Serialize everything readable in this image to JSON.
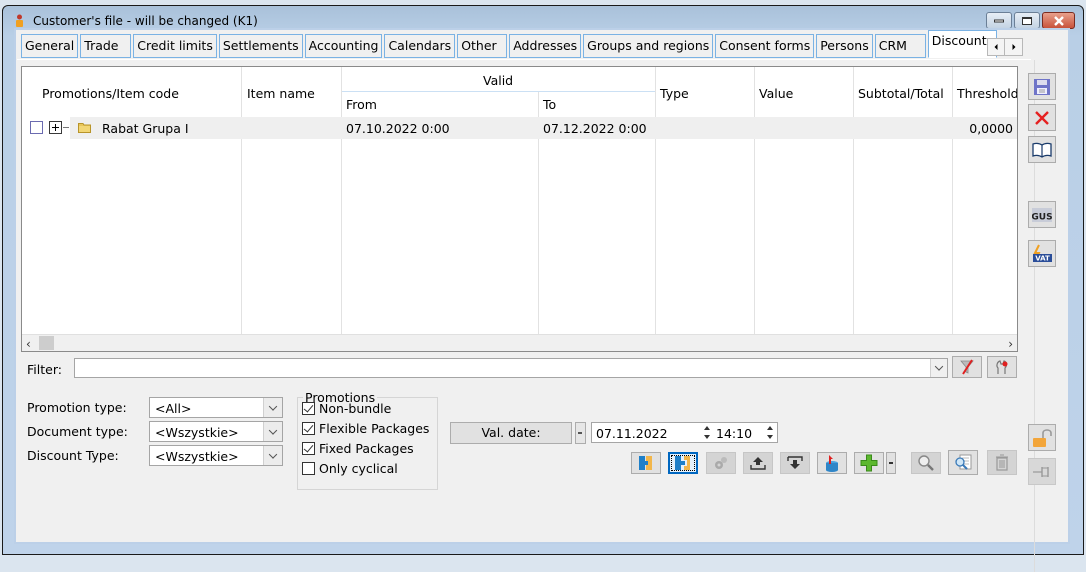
{
  "window": {
    "title": "Customer's file - will be changed (K1)",
    "controls": [
      "minimize",
      "maximize",
      "close"
    ]
  },
  "tabs": [
    {
      "label": "General",
      "active": false
    },
    {
      "label": "Trade",
      "active": false
    },
    {
      "label": "Credit limits",
      "active": false
    },
    {
      "label": "Settlements",
      "active": false
    },
    {
      "label": "Accounting",
      "active": false
    },
    {
      "label": "Calendars",
      "active": false
    },
    {
      "label": "Other",
      "active": false
    },
    {
      "label": "Addresses",
      "active": false
    },
    {
      "label": "Groups and regions",
      "active": false
    },
    {
      "label": "Consent forms",
      "active": false
    },
    {
      "label": "Persons",
      "active": false
    },
    {
      "label": "CRM",
      "active": false
    },
    {
      "label": "Discounts",
      "active": true
    }
  ],
  "grid": {
    "columns": {
      "code": "Promotions/Item code",
      "name": "Item name",
      "valid": "Valid",
      "from": "From",
      "to": "To",
      "type": "Type",
      "value": "Value",
      "subtotal": "Subtotal/Total",
      "threshold": "Threshold"
    },
    "rows": [
      {
        "checked": false,
        "expandable": true,
        "icon": "folder-icon",
        "code": "Rabat Grupa I",
        "name": "",
        "from": "07.10.2022  0:00",
        "to": "07.12.2022  0:00",
        "type": "",
        "value": "",
        "subtotal": "",
        "threshold": "0,0000"
      }
    ]
  },
  "filter": {
    "label": "Filter:",
    "value": "",
    "clear_icon": "clear-filter-icon",
    "build_icon": "filter-builder-icon"
  },
  "form": {
    "promotion_type": {
      "label": "Promotion type:",
      "value": "<All>"
    },
    "document_type": {
      "label": "Document type:",
      "value": "<Wszystkie>"
    },
    "discount_type": {
      "label": "Discount Type:",
      "value": "<Wszystkie>"
    }
  },
  "promotions": {
    "title": "Promotions",
    "options": [
      {
        "label": "Non-bundle",
        "checked": true
      },
      {
        "label": "Flexible Packages",
        "checked": true
      },
      {
        "label": "Fixed Packages",
        "checked": true
      },
      {
        "label": "Only cyclical",
        "checked": false
      }
    ]
  },
  "validity": {
    "button_label": "Val. date:",
    "date": "07.11.2022",
    "time": "14:10"
  },
  "toolbar": [
    {
      "name": "attach-button",
      "icon": "attach-icon",
      "disabled": false
    },
    {
      "name": "attach-all-button",
      "icon": "attach-all-icon",
      "disabled": false,
      "focused": true
    },
    {
      "name": "settings-button",
      "icon": "gears-icon",
      "disabled": true
    },
    {
      "name": "export-button",
      "icon": "export-icon",
      "disabled": true
    },
    {
      "name": "import-button",
      "icon": "import-icon",
      "disabled": true
    },
    {
      "name": "load-button",
      "icon": "database-load-icon",
      "disabled": false
    },
    {
      "name": "add-button",
      "icon": "plus-icon",
      "disabled": false
    },
    {
      "name": "search-button",
      "icon": "magnifier-icon",
      "disabled": true
    },
    {
      "name": "preview-button",
      "icon": "document-search-icon",
      "disabled": false
    },
    {
      "name": "delete-button",
      "icon": "trash-icon",
      "disabled": true
    }
  ],
  "side_toolbar": [
    {
      "name": "save-button",
      "icon": "floppy-disk-icon"
    },
    {
      "name": "cancel-button",
      "icon": "close-x-icon"
    },
    {
      "name": "book-button",
      "icon": "book-icon"
    },
    {
      "name": "gus-button",
      "icon": "gus-icon",
      "text": "GUS"
    },
    {
      "name": "vat-button",
      "icon": "vat-icon",
      "text": "VAT"
    },
    {
      "name": "unlock-button",
      "icon": "padlock-open-icon"
    },
    {
      "name": "pin-button",
      "icon": "pin-icon",
      "disabled": true
    }
  ]
}
